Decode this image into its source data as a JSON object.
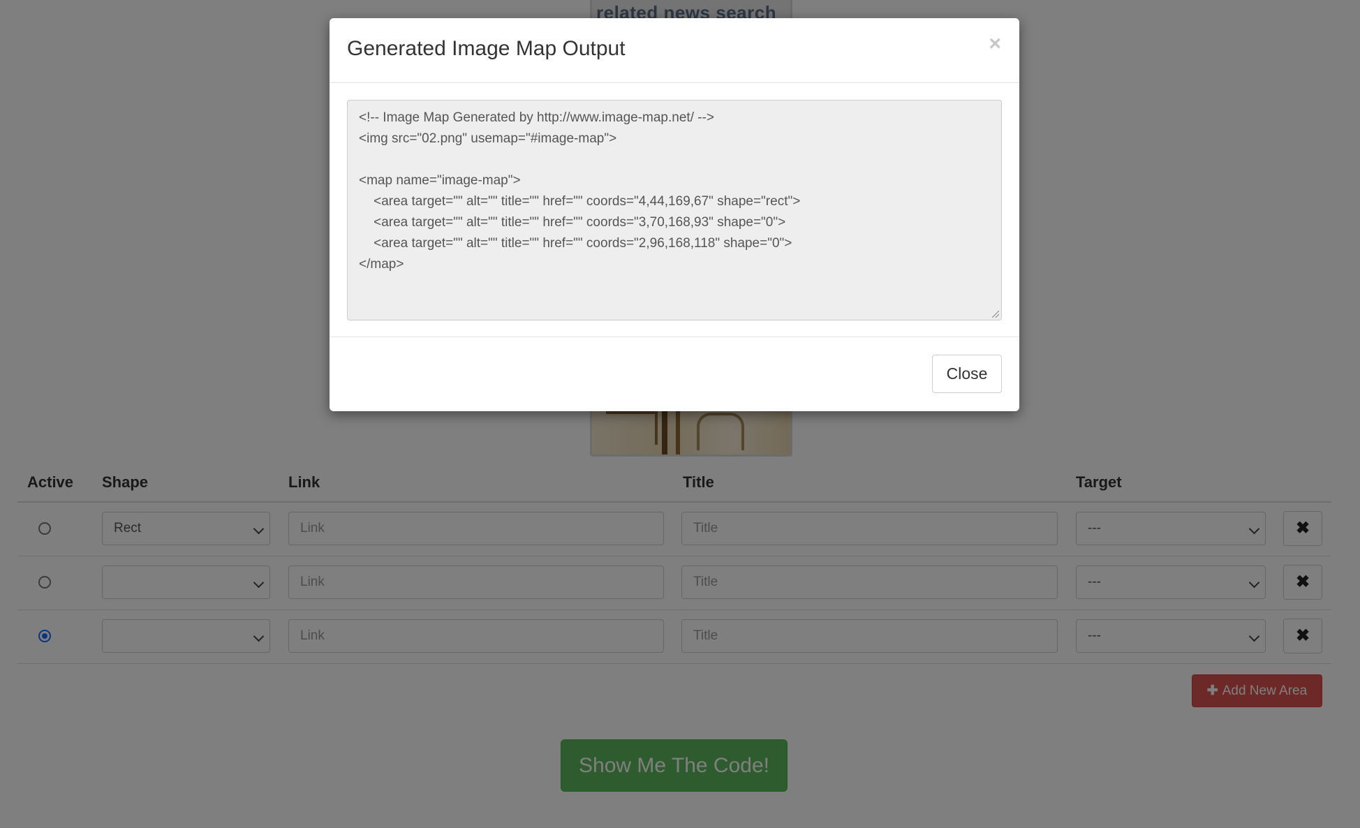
{
  "image_thumbnail": {
    "top_text": "related news search"
  },
  "table": {
    "headers": {
      "active": "Active",
      "shape": "Shape",
      "link": "Link",
      "title": "Title",
      "target": "Target"
    },
    "rows": [
      {
        "active": false,
        "shape": "Rect",
        "link_placeholder": "Link",
        "title_placeholder": "Title",
        "target": "---",
        "delete_icon": "✖"
      },
      {
        "active": false,
        "shape": "",
        "link_placeholder": "Link",
        "title_placeholder": "Title",
        "target": "---",
        "delete_icon": "✖"
      },
      {
        "active": true,
        "shape": "",
        "link_placeholder": "Link",
        "title_placeholder": "Title",
        "target": "---",
        "delete_icon": "✖"
      }
    ],
    "add_button": {
      "icon": "✚",
      "label": "Add New Area"
    }
  },
  "show_code_button": "Show Me The Code!",
  "modal": {
    "title": "Generated Image Map Output",
    "close_x": "×",
    "code_lines": [
      "<!-- Image Map Generated by http://www.image-map.net/ -->",
      "<img src=\"02.png\" usemap=\"#image-map\">",
      "",
      "<map name=\"image-map\">",
      "    <area target=\"\" alt=\"\" title=\"\" href=\"\" coords=\"4,44,169,67\" shape=\"rect\">",
      "    <area target=\"\" alt=\"\" title=\"\" href=\"\" coords=\"3,70,168,93\" shape=\"0\">",
      "    <area target=\"\" alt=\"\" title=\"\" href=\"\" coords=\"2,96,168,118\" shape=\"0\">",
      "</map>"
    ],
    "close_button": "Close"
  },
  "colors": {
    "backdrop": "#000000",
    "add_button": "#d9534f",
    "show_button": "#5cb85c",
    "radio_checked": "#0d6efd"
  }
}
